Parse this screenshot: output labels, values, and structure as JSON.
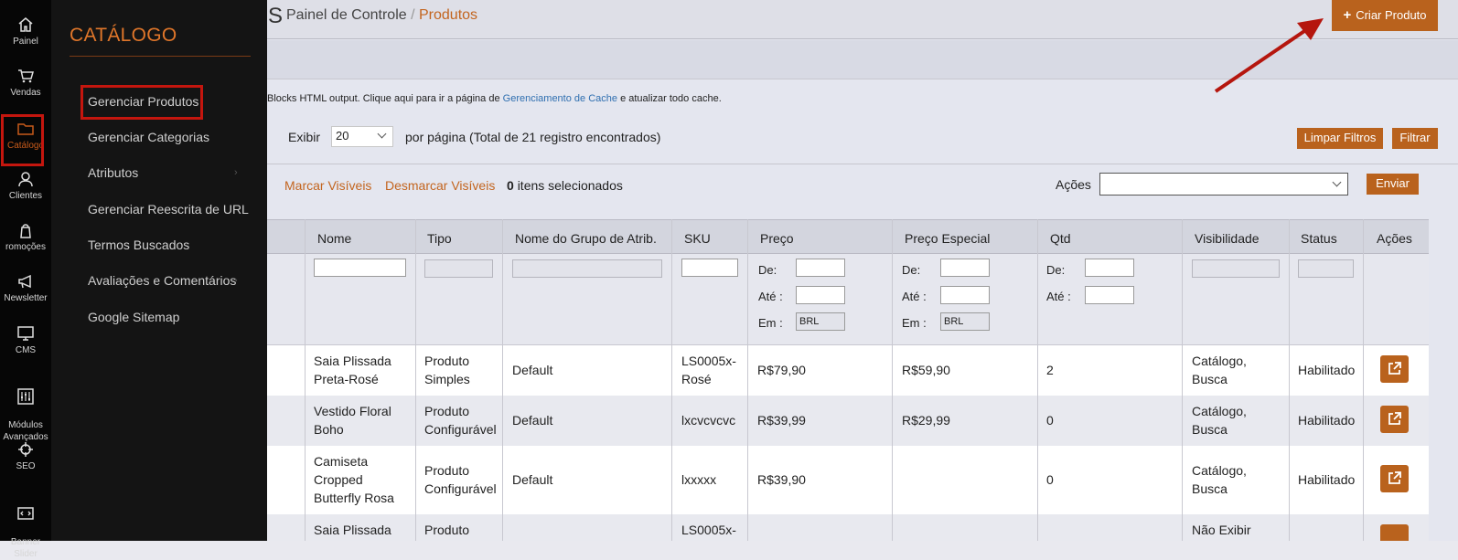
{
  "rail": [
    {
      "label": "Painel",
      "icon": "home-icon"
    },
    {
      "label": "Vendas",
      "icon": "cart-icon"
    },
    {
      "label": "Catálogo",
      "icon": "folder-icon",
      "active": true
    },
    {
      "label": "Clientes",
      "icon": "user-icon"
    },
    {
      "label": "romoções",
      "icon": "bag-icon"
    },
    {
      "label": "Newsletter",
      "icon": "megaphone-icon"
    },
    {
      "label": "CMS",
      "icon": "monitor-icon"
    },
    {
      "label": "Módulos\nAvançados",
      "icon": "sliders-icon"
    },
    {
      "label": "SEO",
      "icon": "target-icon"
    },
    {
      "label": "Banner\nSlider",
      "icon": "banner-icon"
    }
  ],
  "flyout": {
    "title": "CATÁLOGO",
    "items": [
      "Gerenciar Produtos",
      "Gerenciar Categorias",
      "Atributos",
      "Gerenciar Reescrita de URL",
      "Termos Buscados",
      "Avaliações e Comentários",
      "Google Sitemap"
    ]
  },
  "header": {
    "title_fragment": "S",
    "breadcrumb_root": "Painel de Controle",
    "breadcrumb_sep": "/",
    "breadcrumb_current": "Produtos",
    "create_button": "Criar Produto",
    "create_icon": "+"
  },
  "notice": {
    "prefix": "Blocks HTML output. Clique aqui para ir a página de",
    "link": "Gerenciamento de Cache",
    "suffix": "e atualizar todo cache."
  },
  "pager": {
    "show_label": "Exibir",
    "per_page_value": "20",
    "per_page_suffix": "por página (Total de 21 registro encontrados)"
  },
  "filter_buttons": {
    "clear": "Limpar Filtros",
    "filter": "Filtrar"
  },
  "mass": {
    "select_visible": "Marcar Visíveis",
    "unselect_visible": "Desmarcar Visíveis",
    "selected_count": "0",
    "selected_suffix": "itens selecionados",
    "actions_label": "Ações",
    "actions_value": "",
    "submit": "Enviar"
  },
  "table": {
    "columns": [
      "Nome",
      "Tipo",
      "Nome do Grupo de Atrib.",
      "SKU",
      "Preço",
      "Preço Especial",
      "Qtd",
      "Visibilidade",
      "Status",
      "Ações"
    ],
    "filter_labels": {
      "from": "De:",
      "to": "Até :",
      "in": "Em :"
    },
    "currency": "BRL",
    "rows": [
      {
        "name": "Saia Plissada Preta-Rosé",
        "type": "Produto Simples",
        "attr_set": "Default",
        "sku": "LS0005x-Rosé",
        "price": "R$79,90",
        "special": "R$59,90",
        "qty": "2",
        "visibility": "Catálogo, Busca",
        "status": "Habilitado"
      },
      {
        "name": "Vestido Floral Boho",
        "type": "Produto Configurável",
        "attr_set": "Default",
        "sku": "lxcvcvcvc",
        "price": "R$39,99",
        "special": "R$29,99",
        "qty": "0",
        "visibility": "Catálogo, Busca",
        "status": "Habilitado"
      },
      {
        "name": "Camiseta Cropped Butterfly Rosa",
        "type": "Produto Configurável",
        "attr_set": "Default",
        "sku": "lxxxxx",
        "price": "R$39,90",
        "special": "",
        "qty": "0",
        "visibility": "Catálogo, Busca",
        "status": "Habilitado"
      },
      {
        "name": "Saia Plissada",
        "type": "Produto",
        "attr_set": "",
        "sku": "LS0005x-",
        "price": "",
        "special": "",
        "qty": "",
        "visibility": "Não Exibir",
        "status": ""
      }
    ]
  }
}
